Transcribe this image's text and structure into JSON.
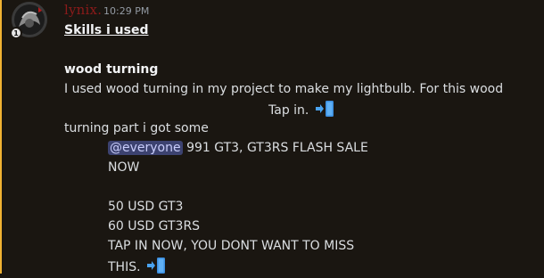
{
  "message": {
    "username": "lynix.",
    "timestamp": "10:29 PM",
    "avatar_icon": "dark-avatar-icon",
    "badge_icon": "one-badge-icon",
    "heading": "Skills i used",
    "section_title": "wood turning",
    "paragraph_line1": "I used wood turning in my project to make my lightbulb. For this wood",
    "tap_in": "Tap in.",
    "paragraph_line2": "turning part i got some",
    "mention": "@everyone",
    "sale_text": "991 GT3, GT3RS FLASH SALE",
    "now": "NOW",
    "price1": "50 USD GT3",
    "price2": "60 USD GT3RS",
    "tap_now": "TAP IN NOW, YOU DONT WANT TO MISS",
    "this": "THIS.",
    "arrow_icon": "arrow-right-emoji-icon"
  },
  "colors": {
    "background": "#1a1611",
    "username": "#8b1a1a",
    "mention_bg": "#3c4270",
    "accent_bar": "#f0b232"
  }
}
